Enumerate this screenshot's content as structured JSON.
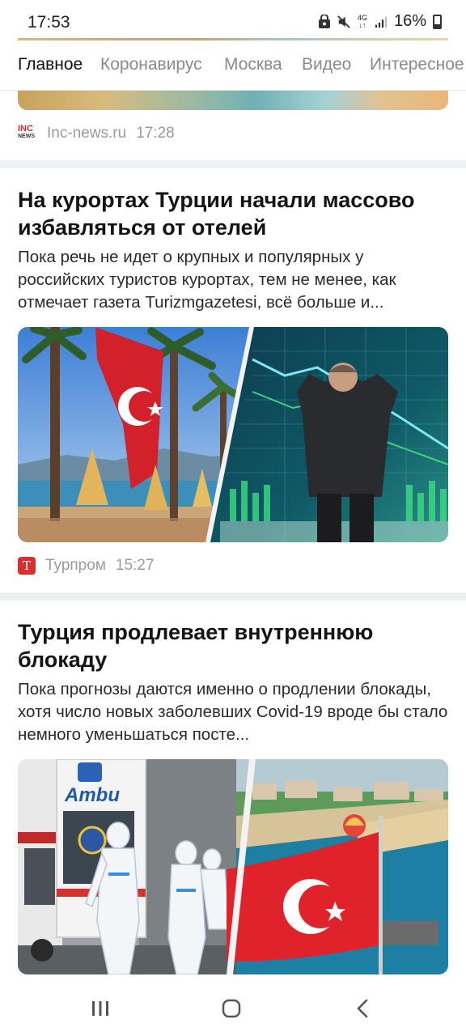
{
  "status": {
    "time": "17:53",
    "network": "4G",
    "battery": "16%"
  },
  "tabs": [
    {
      "label": "Главное",
      "active": true
    },
    {
      "label": "Коронавирус",
      "active": false
    },
    {
      "label": "Москва",
      "active": false
    },
    {
      "label": "Видео",
      "active": false
    },
    {
      "label": "Интересное",
      "active": false
    }
  ],
  "prev_card": {
    "source": "Inc-news.ru",
    "time": "17:28",
    "logo": {
      "top": "INC",
      "bottom": "NEWS"
    }
  },
  "cards": [
    {
      "title": "На курортах Турции начали массово избавляться от отелей",
      "snippet": "Пока речь не идет о крупных и популярных у российских туристов курортах, тем не менее, как отмечает газета Turizmgazetesi, всё больше и...",
      "source": "Турпром",
      "time": "15:27",
      "logo_glyph": "Т"
    },
    {
      "title": "Турция продлевает внутреннюю блокаду",
      "snippet": "Пока прогнозы даются именно о продлении блокады, хотя число новых заболевших Covid-19 вроде бы стало немного уменьшаться посте...",
      "ambulance_text": "Ambu"
    }
  ],
  "icons": {
    "recent_apps": "recent-apps-icon",
    "home": "home-icon",
    "back": "back-icon"
  },
  "colors": {
    "accent_red": "#d82f2f",
    "muted": "#8a8a8a",
    "divider": "#eef0f2"
  }
}
